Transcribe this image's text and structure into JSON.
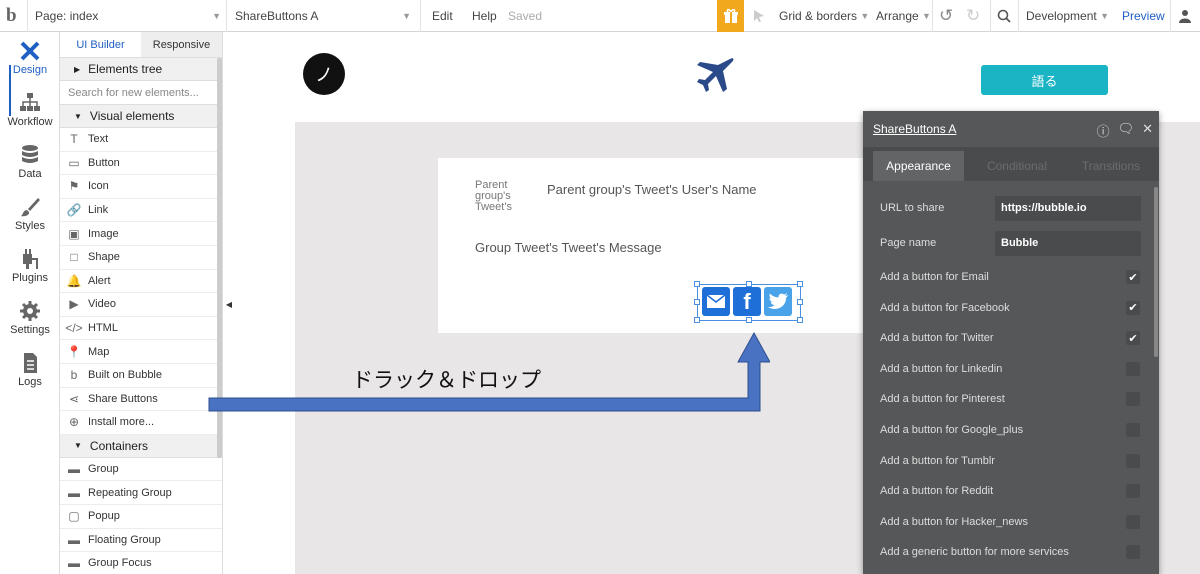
{
  "topbar": {
    "logo": "b",
    "page_label": "Page: index",
    "element_label": "ShareButtons A",
    "edit": "Edit",
    "help": "Help",
    "saved": "Saved",
    "grid": "Grid & borders",
    "arrange": "Arrange",
    "development": "Development",
    "preview": "Preview"
  },
  "iconbar": {
    "items": [
      {
        "label": "Design",
        "icon": "design-icon"
      },
      {
        "label": "Workflow",
        "icon": "workflow-icon"
      },
      {
        "label": "Data",
        "icon": "database-icon"
      },
      {
        "label": "Styles",
        "icon": "brush-icon"
      },
      {
        "label": "Plugins",
        "icon": "plug-icon"
      },
      {
        "label": "Settings",
        "icon": "gear-icon"
      },
      {
        "label": "Logs",
        "icon": "document-icon"
      }
    ]
  },
  "panel": {
    "tab_builder": "UI Builder",
    "tab_responsive": "Responsive",
    "elements_tree": "Elements tree",
    "search_placeholder": "Search for new elements...",
    "visual_header": "Visual elements",
    "visual_items": [
      {
        "label": "Text",
        "icon": "text-icon"
      },
      {
        "label": "Button",
        "icon": "button-icon"
      },
      {
        "label": "Icon",
        "icon": "flag-icon"
      },
      {
        "label": "Link",
        "icon": "link-icon"
      },
      {
        "label": "Image",
        "icon": "image-icon"
      },
      {
        "label": "Shape",
        "icon": "shape-icon"
      },
      {
        "label": "Alert",
        "icon": "bell-icon"
      },
      {
        "label": "Video",
        "icon": "video-icon"
      },
      {
        "label": "HTML",
        "icon": "code-icon"
      },
      {
        "label": "Map",
        "icon": "map-pin-icon"
      },
      {
        "label": "Built on Bubble",
        "icon": "bubble-logo-icon"
      },
      {
        "label": "Share Buttons",
        "icon": "share-icon"
      },
      {
        "label": "Install more...",
        "icon": "plus-circle-icon"
      }
    ],
    "containers_header": "Containers",
    "container_items": [
      {
        "label": "Group",
        "icon": "folder-icon"
      },
      {
        "label": "Repeating Group",
        "icon": "folder-icon"
      },
      {
        "label": "Popup",
        "icon": "popup-icon"
      },
      {
        "label": "Floating Group",
        "icon": "folder-icon"
      },
      {
        "label": "Group Focus",
        "icon": "folder-icon"
      }
    ]
  },
  "canvas": {
    "phone_glyph": "ノ",
    "teal_button": "語る",
    "avatar_alt": "Parent group's Tweet's",
    "username": "Parent group's Tweet's User's Name",
    "message": "Group Tweet's Tweet's Message",
    "drag_drop": "ドラック＆ドロップ",
    "share_icons": [
      "email-icon",
      "facebook-icon",
      "twitter-icon"
    ]
  },
  "editor": {
    "title": "ShareButtons A",
    "tabs": [
      "Appearance",
      "Conditional",
      "Transitions"
    ],
    "fields": [
      {
        "label": "URL to share",
        "value": "https://bubble.io"
      },
      {
        "label": "Page name",
        "value": "Bubble"
      }
    ],
    "checks": [
      {
        "label": "Add a button for Email",
        "checked": true
      },
      {
        "label": "Add a button for Facebook",
        "checked": true
      },
      {
        "label": "Add a button for Twitter",
        "checked": true
      },
      {
        "label": "Add a button for Linkedin",
        "checked": false
      },
      {
        "label": "Add a button for Pinterest",
        "checked": false
      },
      {
        "label": "Add a button for Google_plus",
        "checked": false
      },
      {
        "label": "Add a button for Tumblr",
        "checked": false
      },
      {
        "label": "Add a button for Reddit",
        "checked": false
      },
      {
        "label": "Add a button for Hacker_news",
        "checked": false
      },
      {
        "label": "Add a generic button for more services",
        "checked": false
      }
    ]
  },
  "colors": {
    "accent": "#1f5fc4",
    "teal": "#1bb4c4",
    "gift": "#f2a81d",
    "email": "#1f6fd8",
    "facebook": "#1f6fd8",
    "twitter": "#4aa3e8",
    "editor_bg": "#565759"
  }
}
